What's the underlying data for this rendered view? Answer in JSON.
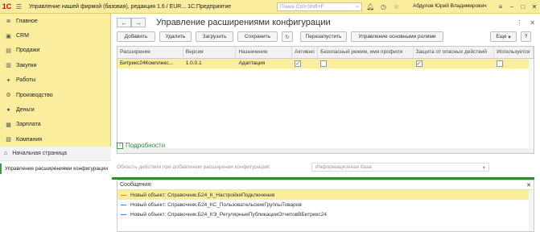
{
  "titlebar": {
    "logo_text": "1C",
    "app_title": "Управление нашей фирмой (базовая), редакция 1.6 / EUR... 1С:Предприятие",
    "search_placeholder": "Поиск Ctrl+Shift+F",
    "user": "Абдулов Юрий Владимирович",
    "icons": [
      "grid-icon",
      "apps-icon",
      "bell-icon",
      "history-icon",
      "star-icon"
    ],
    "accent": "#fbed9e"
  },
  "sidebar": {
    "items": [
      {
        "label": "Главное",
        "icon": "home-list-icon"
      },
      {
        "label": "CRM",
        "icon": "crm-icon"
      },
      {
        "label": "Продажи",
        "icon": "sales-icon"
      },
      {
        "label": "Закупки",
        "icon": "cart-icon"
      },
      {
        "label": "Работы",
        "icon": "tools-icon"
      },
      {
        "label": "Производство",
        "icon": "factory-icon"
      },
      {
        "label": "Деньги",
        "icon": "money-icon"
      },
      {
        "label": "Зарплата",
        "icon": "salary-icon"
      },
      {
        "label": "Компания",
        "icon": "company-icon"
      }
    ],
    "home_label": "Начальная страница",
    "open_form": "Управление расширениями конфигурации"
  },
  "form": {
    "title": "Управление расширениями конфигурации",
    "toolbar": {
      "add": "Добавить",
      "delete": "Удалить",
      "load": "Загрузить",
      "save": "Сохранить",
      "restart": "Перезапустить",
      "roles": "Управление основными ролями",
      "more": "Еще",
      "help": "?"
    },
    "columns": [
      "Расширение",
      "Версия",
      "Назначение",
      "Активно",
      "Безопасный режим, имя профиля",
      "Защита от опасных действий",
      "Используется"
    ],
    "rows": [
      {
        "name": "Битрикс24Комплекс...",
        "version": "1.0.0.1",
        "purpose": "Адаптация",
        "active": true,
        "safe_mode": false,
        "protection": true,
        "used": false
      }
    ],
    "details_label": "Подробности",
    "scope_label": "Область действия при добавлении расширения конфигурации:",
    "scope_value": "Информационная база",
    "messages_title": "Сообщения:",
    "messages": [
      "Новый объект: Справочник.Б24_К_НастройкиПодключения",
      "Новый объект: Справочник.Б24_КС_ПользовательскиеГруппыТоваров",
      "Новый объект: Справочник.Б24_КЭ_РегулярныеПубликацииОтчетовВБитрикс24"
    ]
  }
}
